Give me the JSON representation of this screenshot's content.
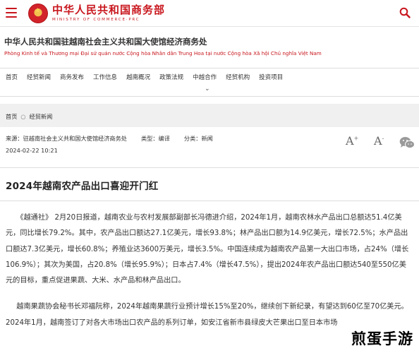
{
  "header": {
    "ministry_cn": "中华人民共和国商务部",
    "ministry_en": "MINISTRY OF COMMERCE·PRC"
  },
  "office": {
    "name_cn": "中华人民共和国驻越南社会主义共和国大使馆经济商务处",
    "name_vn": "Phòng Kinh tế và Thương mại Đại sứ quán nước Cộng hòa Nhân dân Trung Hoa tại nước Cộng hòa Xã hội Chủ nghĩa Việt Nam"
  },
  "nav": {
    "items": [
      {
        "label": "首页"
      },
      {
        "label": "经贸新闻"
      },
      {
        "label": "商务发布"
      },
      {
        "label": "工作信息"
      },
      {
        "label": "越南概况"
      },
      {
        "label": "政策法规"
      },
      {
        "label": "中越合作"
      },
      {
        "label": "经贸机构"
      },
      {
        "label": "投资项目"
      }
    ],
    "expand_glyph": "⌄"
  },
  "breadcrumb": {
    "home": "首页",
    "separator": "○",
    "current": "经贸新闻"
  },
  "meta": {
    "source": "来源：驻越南社会主义共和国大使馆经济商务处",
    "type": "类型：编译",
    "category": "分类：新闻",
    "date": "2024-02-22 10:21",
    "font_large": "A",
    "font_small": "A",
    "font_large_sup": "+",
    "font_small_sup": "-"
  },
  "article": {
    "title": "2024年越南农产品出口喜迎开门红",
    "paragraphs": [
      "《越通社》 2月20日报道，越南农业与农村发展部副部长冯德进介绍，2024年1月，越南农林水产品出口总额达51.4亿美元，同比增长79.2%。其中，农产品出口额达27.1亿美元，增长93.8%；林产品出口额为14.9亿美元，增长72.5%；水产品出口额达7.3亿美元，增长60.8%；养殖业达3600万美元，增长3.5%。中国连续成为越南农产品第一大出口市场，占24%（增长106.9%）；其次为美国，占20.8%（增长95.9%）；日本占7.4%（增长47.5%），提出2024年农产品出口额达540至550亿美元的目标，重点促进果蔬、大米、水产品和林产品出口。",
      "越南果蔬协会秘书长邓福阮称，2024年越南果蔬行业预计增长15%至20%，继续创下新纪录，有望达到60亿至70亿美元。2024年1月，越南签订了对各大市场出口农产品的系列订单，如安江省新市县绿皮大芒果出口至日本市场"
    ]
  },
  "watermark": "煎蛋手游",
  "colors": {
    "brand_red": "#c8161d",
    "breadcrumb_bg": "#f0f0f0"
  }
}
